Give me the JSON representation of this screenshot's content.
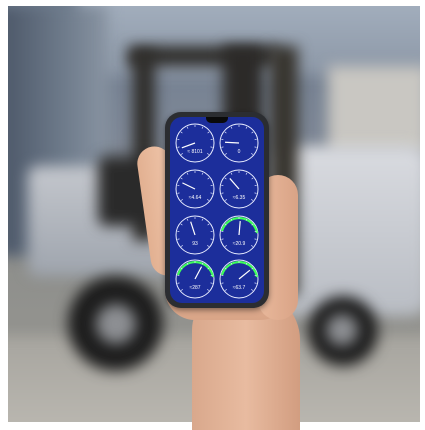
{
  "phone_app": {
    "gauges": [
      {
        "reading": "≈ 8101",
        "label": "",
        "accent": "#ffffff"
      },
      {
        "reading": "0",
        "label": "",
        "accent": "#ffffff"
      },
      {
        "reading": "≈4.64",
        "label": "",
        "accent": "#ffffff"
      },
      {
        "reading": "≈6.35",
        "label": "",
        "accent": "#ffffff"
      },
      {
        "reading": "93",
        "label": "",
        "accent": "#ffffff"
      },
      {
        "reading": "≈20.9",
        "label": "",
        "accent": "#3dff5a"
      },
      {
        "reading": "≈287",
        "label": "",
        "accent": "#3dff5a"
      },
      {
        "reading": "≈63.7",
        "label": "",
        "accent": "#3dff5a"
      }
    ],
    "screen_color": "#1c2e9b"
  },
  "icons": [
    "forklift-background",
    "smartphone",
    "hand"
  ]
}
